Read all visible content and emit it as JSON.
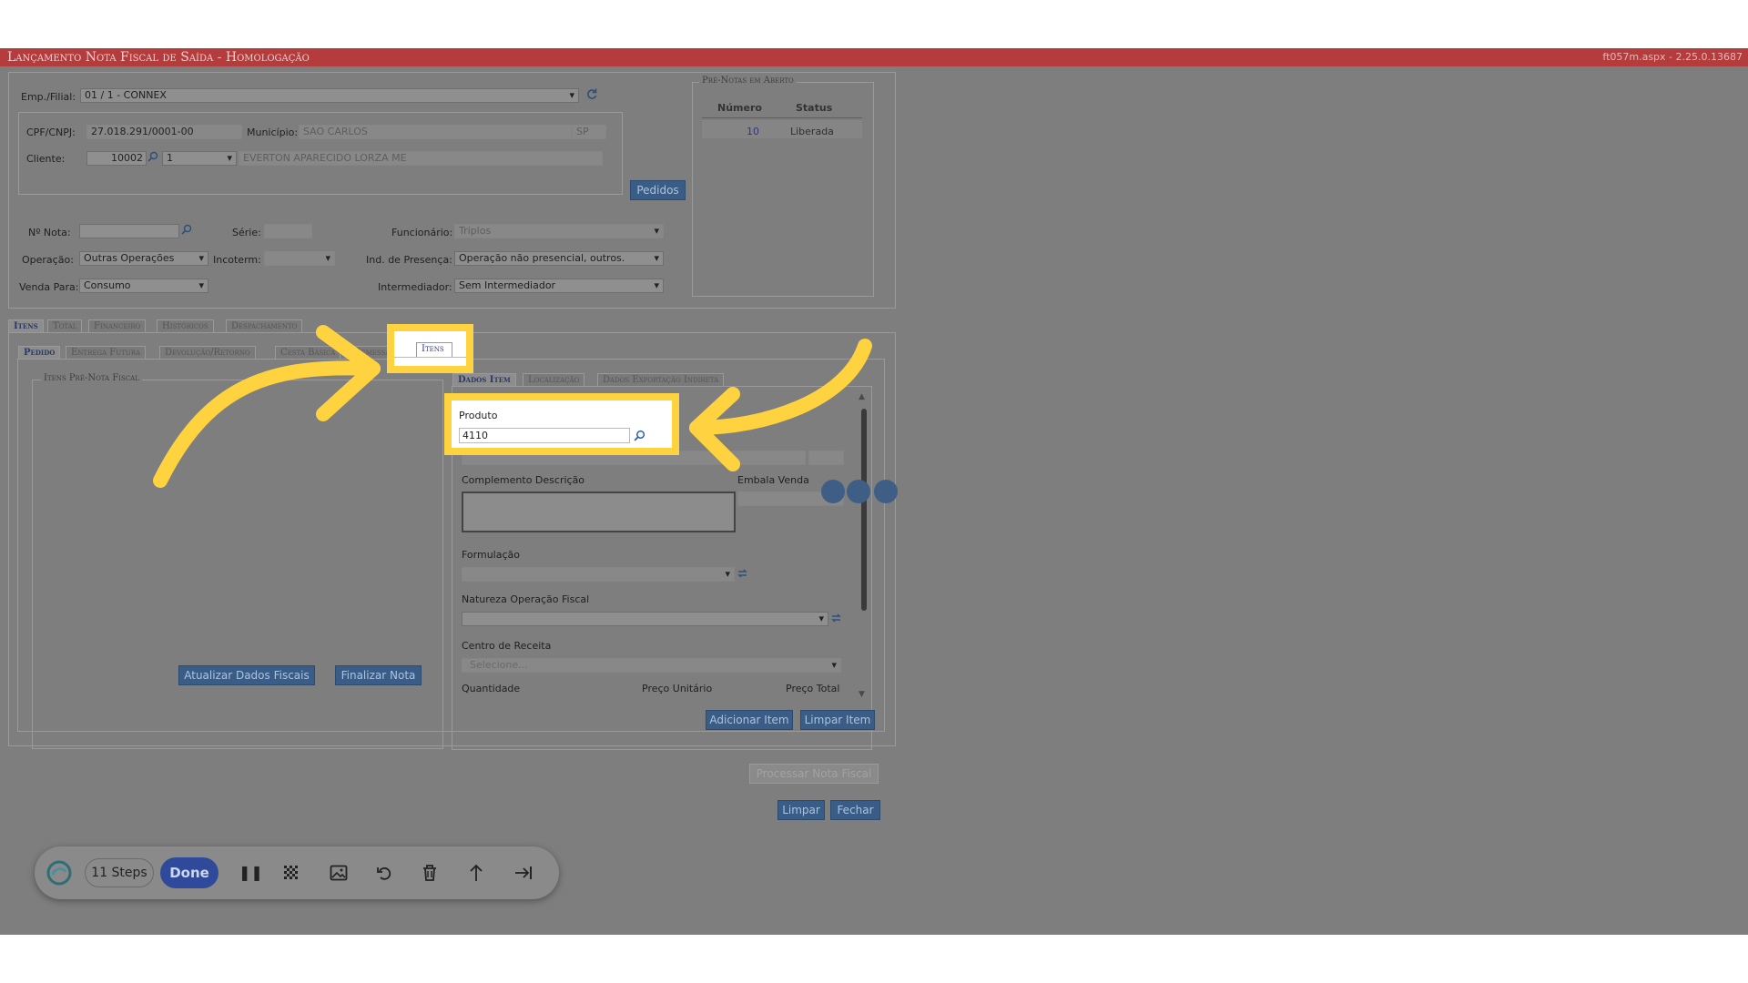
{
  "window": {
    "title": "Lançamento Nota Fiscal de Saída - Homologação",
    "version": "ft057m.aspx - 2.25.0.13687"
  },
  "header": {
    "emp_label": "Emp./Filial:",
    "emp_value": "01 / 1 - CONNEX",
    "cpf_label": "CPF/CNPJ:",
    "cpf_value": "27.018.291/0001-00",
    "municipio_label": "Município:",
    "municipio_value": "SAO CARLOS",
    "uf_value": "SP",
    "cliente_label": "Cliente:",
    "cliente_code": "10002",
    "cliente_seq": "1",
    "cliente_name": "EVERTON APARECIDO LORZA ME",
    "pedidos_button": "Pedidos",
    "nota_label": "Nº Nota:",
    "nota_value": "",
    "serie_label": "Série:",
    "serie_value": "",
    "funcionario_label": "Funcionário:",
    "funcionario_value": "Triplos",
    "operacao_label": "Operação:",
    "operacao_value": "Outras Operações",
    "incoterm_label": "Incoterm:",
    "incoterm_value": "",
    "presenca_label": "Ind. de Presença:",
    "presenca_value": "Operação não presencial, outros.",
    "venda_label": "Venda Para:",
    "venda_value": "Consumo",
    "intermediador_label": "Intermediador:",
    "intermediador_value": "Sem Intermediador"
  },
  "prenotas": {
    "legend": "Pré-Notas em Aberto",
    "columns": [
      "Número",
      "Status"
    ],
    "rows": [
      {
        "numero": "10",
        "status": "Liberada"
      }
    ]
  },
  "tabs_main": [
    "Itens",
    "Total",
    "Financeiro",
    "Históricos",
    "Despachamento"
  ],
  "tabs_sub": [
    "Pedido",
    "Entrega Futura",
    "Devolução/Retorno",
    "Cesta Básica",
    "Remessa",
    "Itens"
  ],
  "tabs_item": [
    "Dados Item",
    "Localização",
    "Dados Exportação Indireta"
  ],
  "left_panel": {
    "legend": "Itens Pré-Nota Fiscal",
    "btn_atualizar": "Atualizar Dados Fiscais",
    "btn_finalizar": "Finalizar Nota"
  },
  "item_form": {
    "produto_label": "Produto",
    "produto_value": "4110",
    "complemento_label": "Complemento Descrição",
    "embala_label": "Embala Venda",
    "formulacao_label": "Formulação",
    "natureza_label": "Natureza Operação Fiscal",
    "centro_label": "Centro de Receita",
    "centro_placeholder": "Selecione...",
    "quantidade_label": "Quantidade",
    "preco_unit_label": "Preço Unitário",
    "preco_total_label": "Preço Total",
    "btn_adicionar": "Adicionar Item",
    "btn_limpar_item": "Limpar Item"
  },
  "footer": {
    "btn_processar": "Processar Nota Fiscal",
    "btn_limpar": "Limpar",
    "btn_fechar": "Fechar"
  },
  "recorder": {
    "steps": "11 Steps",
    "done": "Done"
  },
  "colors": {
    "title_bar": "#b43c3c",
    "button": "#395d86",
    "highlight": "#ffd23f",
    "overlay": "#7e7e7e"
  }
}
